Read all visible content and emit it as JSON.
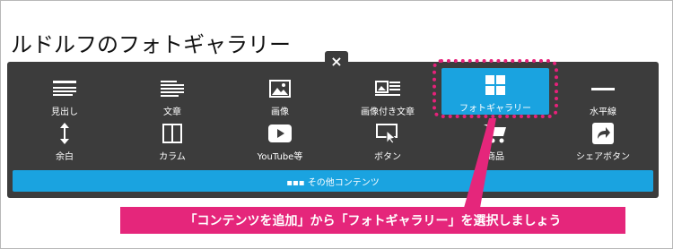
{
  "page": {
    "title": "ルドルフのフォトギャラリー"
  },
  "panel": {
    "close_label": "×",
    "items": [
      {
        "label": "見出し",
        "icon": "heading-icon"
      },
      {
        "label": "文章",
        "icon": "paragraph-icon"
      },
      {
        "label": "画像",
        "icon": "image-icon"
      },
      {
        "label": "画像付き文章",
        "icon": "image-text-icon"
      },
      {
        "label": "フォトギャラリー",
        "icon": "grid-icon",
        "selected": true
      },
      {
        "label": "水平線",
        "icon": "horizontal-line-icon"
      },
      {
        "label": "余白",
        "icon": "vertical-arrow-icon"
      },
      {
        "label": "カラム",
        "icon": "columns-icon"
      },
      {
        "label": "YouTube等",
        "icon": "play-icon"
      },
      {
        "label": "ボタン",
        "icon": "button-cursor-icon"
      },
      {
        "label": "商品",
        "icon": "cart-icon"
      },
      {
        "label": "シェアボタン",
        "icon": "share-icon"
      }
    ],
    "more_label": "▪▪▪ その他コンテンツ"
  },
  "callout": {
    "text": "「コンテンツを追加」から「フォトギャラリー」を選択しましょう"
  },
  "colors": {
    "panel": "#3c3c3c",
    "accent": "#1aa3e0",
    "highlight": "#e5267b"
  }
}
